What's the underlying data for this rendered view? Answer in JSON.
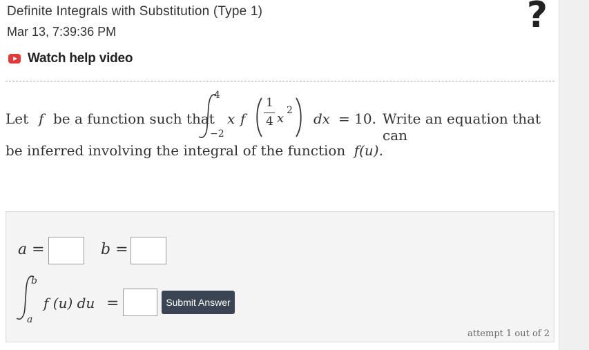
{
  "header": {
    "title": "Definite Integrals with Substitution (Type 1)",
    "timestamp": "Mar 13, 7:39:36 PM",
    "help_video_label": "Watch help video",
    "help_icon": "?"
  },
  "question": {
    "prefix": "Let",
    "f": "f",
    "mid": "be a function such that",
    "upper": "4",
    "lower": "−2",
    "frac_num": "1",
    "frac_den": "4",
    "x": "x",
    "exp": "2",
    "dx": "dx",
    "equals_value": "= 10.",
    "suffix": "Write an equation that can",
    "line2": "be inferred involving the integral of the function",
    "fu": "f(u)."
  },
  "answer": {
    "a_label": "a =",
    "b_label": "b =",
    "int_upper": "b",
    "int_lower": "a",
    "integrand": "f (u) du",
    "eq": "=",
    "a_value": "",
    "b_value": "",
    "integral_value": "",
    "submit_label": "Submit Answer",
    "attempt_text": "attempt 1 out of 2"
  }
}
